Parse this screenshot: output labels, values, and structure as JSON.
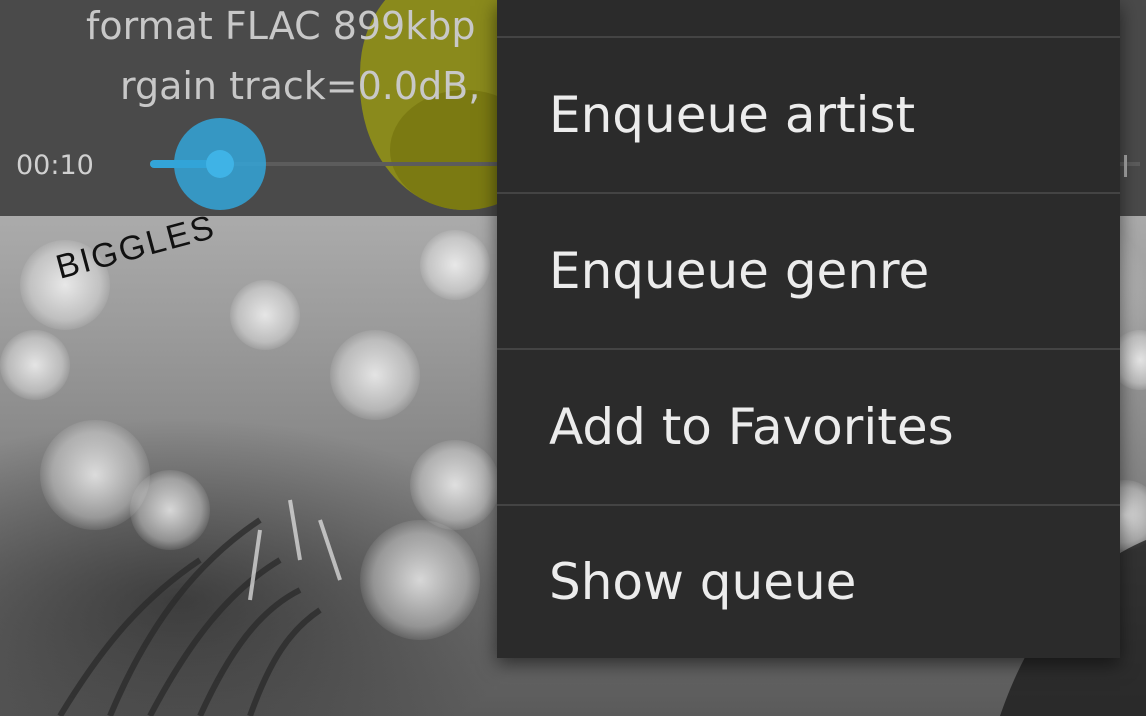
{
  "now_playing": {
    "format_line": "format FLAC 899kbp",
    "rgain_line": "rgain track=0.0dB,",
    "elapsed_time": "00:10",
    "progress_fraction": 0.01
  },
  "album_art": {
    "label": "BIGGLES"
  },
  "overflow_menu": {
    "items": [
      {
        "label": "Enqueue artist"
      },
      {
        "label": "Enqueue genre"
      },
      {
        "label": "Add to Favorites"
      },
      {
        "label": "Show queue"
      }
    ]
  },
  "colors": {
    "accent": "#33a4d8",
    "menu_background": "#2b2b2b",
    "menu_text": "#ececec",
    "topbar_background": "#4a4a4a",
    "visualizer": "#8a8a1c"
  }
}
